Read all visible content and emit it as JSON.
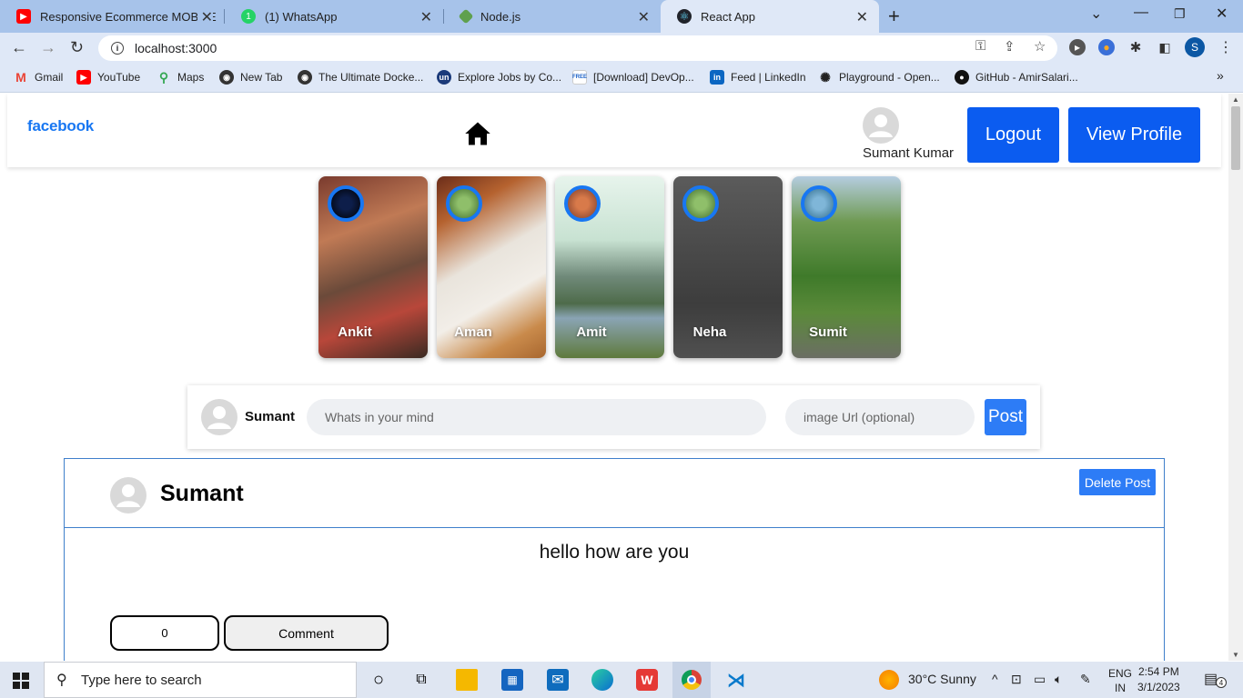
{
  "browser": {
    "tabs": [
      {
        "title": "Responsive Ecommerce MOBILE",
        "icon": "youtube-icon",
        "color": "#ff0000"
      },
      {
        "title": "(1) WhatsApp",
        "icon": "whatsapp-icon",
        "color": "#25d366"
      },
      {
        "title": "Node.js",
        "icon": "nodejs-icon",
        "color": "#5fa04e"
      },
      {
        "title": "React App",
        "icon": "react-icon",
        "color": "#61dafb"
      }
    ],
    "url": "localhost:3000",
    "profile_initial": "S",
    "bookmarks": [
      {
        "label": "Gmail",
        "icon": "gmail-icon"
      },
      {
        "label": "YouTube",
        "icon": "youtube-icon"
      },
      {
        "label": "Maps",
        "icon": "maps-icon"
      },
      {
        "label": "New Tab",
        "icon": "chrome-icon"
      },
      {
        "label": "The Ultimate Docke...",
        "icon": "globe-icon"
      },
      {
        "label": "Explore Jobs by Co...",
        "icon": "un-icon"
      },
      {
        "label": "[Download] DevOp...",
        "icon": "free-icon"
      },
      {
        "label": "Feed | LinkedIn",
        "icon": "linkedin-icon"
      },
      {
        "label": "Playground - Open...",
        "icon": "openai-icon"
      },
      {
        "label": "GitHub - AmirSalari...",
        "icon": "github-icon"
      }
    ]
  },
  "app": {
    "logo": "facebook",
    "user_name": "Sumant Kumar",
    "logout_label": "Logout",
    "view_profile_label": "View Profile",
    "stories": [
      {
        "name": "Ankit"
      },
      {
        "name": "Aman"
      },
      {
        "name": "Amit"
      },
      {
        "name": "Neha"
      },
      {
        "name": "Sumit"
      }
    ],
    "composer": {
      "user": "Sumant",
      "text_placeholder": "Whats in your mind",
      "image_placeholder": "image Url (optional)",
      "post_label": "Post"
    },
    "post": {
      "author": "Sumant",
      "delete_label": "Delete Post",
      "text": "hello how are you",
      "likes": "0",
      "comment_label": "Comment"
    }
  },
  "taskbar": {
    "search_placeholder": "Type here to search",
    "weather": "30°C  Sunny",
    "lang_top": "ENG",
    "lang_bottom": "IN",
    "time": "2:54 PM",
    "date": "3/1/2023",
    "notification_count": "4"
  }
}
